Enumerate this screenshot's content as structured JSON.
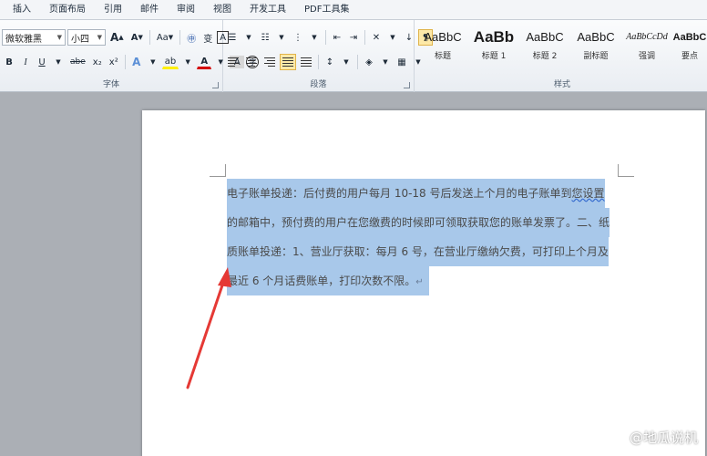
{
  "tabs": [
    "插入",
    "页面布局",
    "引用",
    "邮件",
    "审阅",
    "视图",
    "开发工具",
    "PDF工具集"
  ],
  "font_group": {
    "label": "字体",
    "font_name": "微软雅黑",
    "font_size": "小四",
    "grow": "A",
    "shrink": "A",
    "case": "Aa",
    "clear": "A",
    "bold": "B",
    "italic": "I",
    "underline": "U",
    "strike": "abe",
    "sub": "x₂",
    "sup": "x²",
    "effects": "A",
    "highlight": "ab",
    "color": "A",
    "shade": "A",
    "enclose": "字"
  },
  "paragraph_group": {
    "label": "段落"
  },
  "styles_group": {
    "label": "样式",
    "items": [
      {
        "sample": "AaBbC",
        "name": "标题"
      },
      {
        "sample": "AaBb",
        "name": "标题 1"
      },
      {
        "sample": "AaBbC",
        "name": "标题 2"
      },
      {
        "sample": "AaBbC",
        "name": "副标题"
      },
      {
        "sample": "AaBbCcDd",
        "name": "强调"
      },
      {
        "sample": "AaBbC",
        "name": "要点"
      }
    ]
  },
  "document": {
    "lines": [
      "电子账单投递：后付费的用户每月  10-18  号后发送上个月的电子账单到您设置",
      "的邮箱中，预付费的用户在您缴费的时候即可领取获取您的账单发票了。二、纸",
      "质账单投递：1、营业厅获取：每月 6 号，在营业厅缴纳欠费，可打印上个月及",
      "最近 6 个月话费账单，打印次数不限。"
    ],
    "wavy_text": "您设置",
    "paragraph_mark": "↵"
  },
  "watermark": "@地瓜说机",
  "colors": {
    "highlight": "#a8c8ea",
    "arrow": "#e53935",
    "active_style": "#fbe39b"
  }
}
